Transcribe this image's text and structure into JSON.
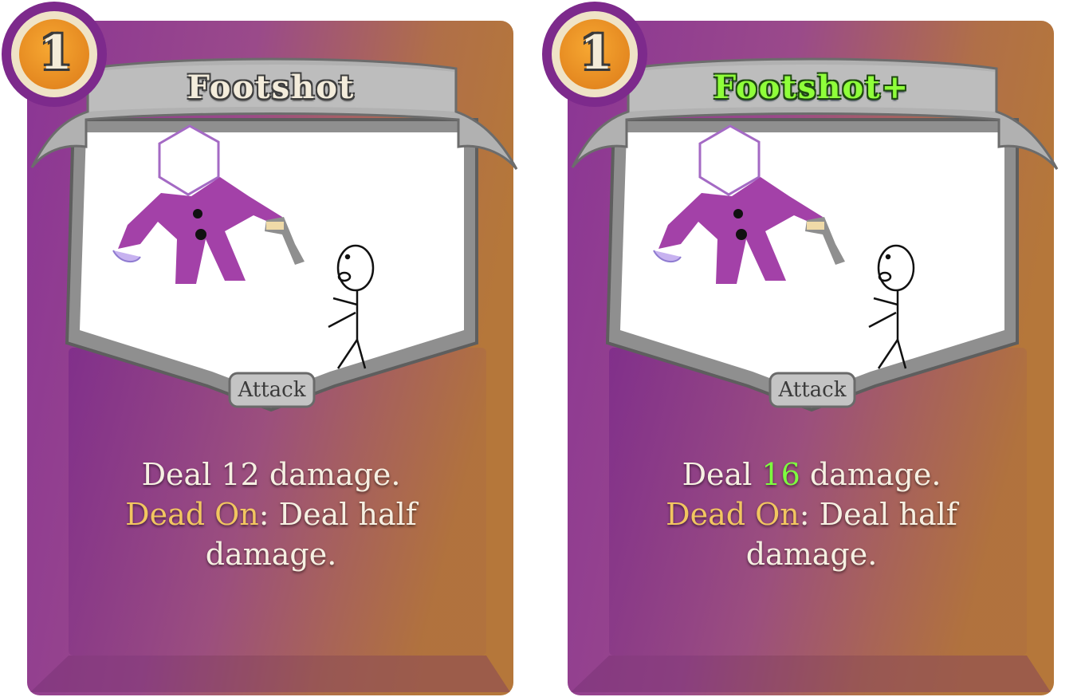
{
  "cards": [
    {
      "cost": "1",
      "name": "Footshot",
      "type": "Attack",
      "desc_pre": "Deal ",
      "damage": "12",
      "desc_mid": " damage.",
      "keyword": "Dead On",
      "desc_post": ": Deal half damage.",
      "upgraded": false
    },
    {
      "cost": "1",
      "name": "Footshot+",
      "type": "Attack",
      "desc_pre": "Deal ",
      "damage": "16",
      "desc_mid": " damage.",
      "keyword": "Dead On",
      "desc_post": ": Deal half damage.",
      "upgraded": true
    }
  ],
  "colors": {
    "card_purple": "#8a3a95",
    "card_orange": "#b87a3a",
    "keyword": "#f2c660",
    "upgrade_green": "#7dff3e",
    "frame_gray": "#a9a9a9"
  }
}
